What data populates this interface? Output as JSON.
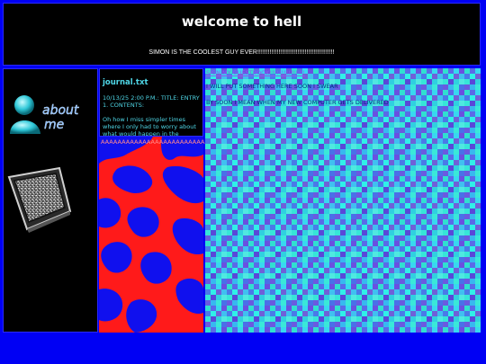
{
  "header": {
    "title": "welcome to hell",
    "subtitle": "SIMON IS THE COOLEST GUY EVER!!!!!!!!!!!!!!!!!!!!!!!!!!!!!!!!!!!!!!!!!!!!"
  },
  "sidebar": {
    "about_me_label": "about me",
    "about_me_icon": "msn-buddy-icon",
    "tv_icon": "tv-static-icon"
  },
  "journal": {
    "title": "journal.txt",
    "entry_header": "10/13/25 2:00 P.M.: TITLE: ENTRY 1. CONTENTS:",
    "entry_body": "Oh how I miss simpler times where I only had to worry about what would happen in the",
    "scream": "AAAAAAAAAAAAAAAAAAAAAAAAAAA"
  },
  "guestbook": {
    "link": "SIGN MY GUESTBOOK!!!!!!!!!!!!!!!",
    "line1": "I WILL PUT SOMETHING HERE SOON I SWEAR",
    "line2": "BY SOON I MEAN WHEN MY NEW COMPUTER GETS DELIVERED"
  },
  "colors": {
    "page_bg": "#0000f4",
    "panel_bg": "#000000",
    "border": "#2a2aff",
    "cyan_text": "#4fd8e8",
    "camo_red": "#ff1a1a",
    "camo_blue": "#1010ee"
  }
}
